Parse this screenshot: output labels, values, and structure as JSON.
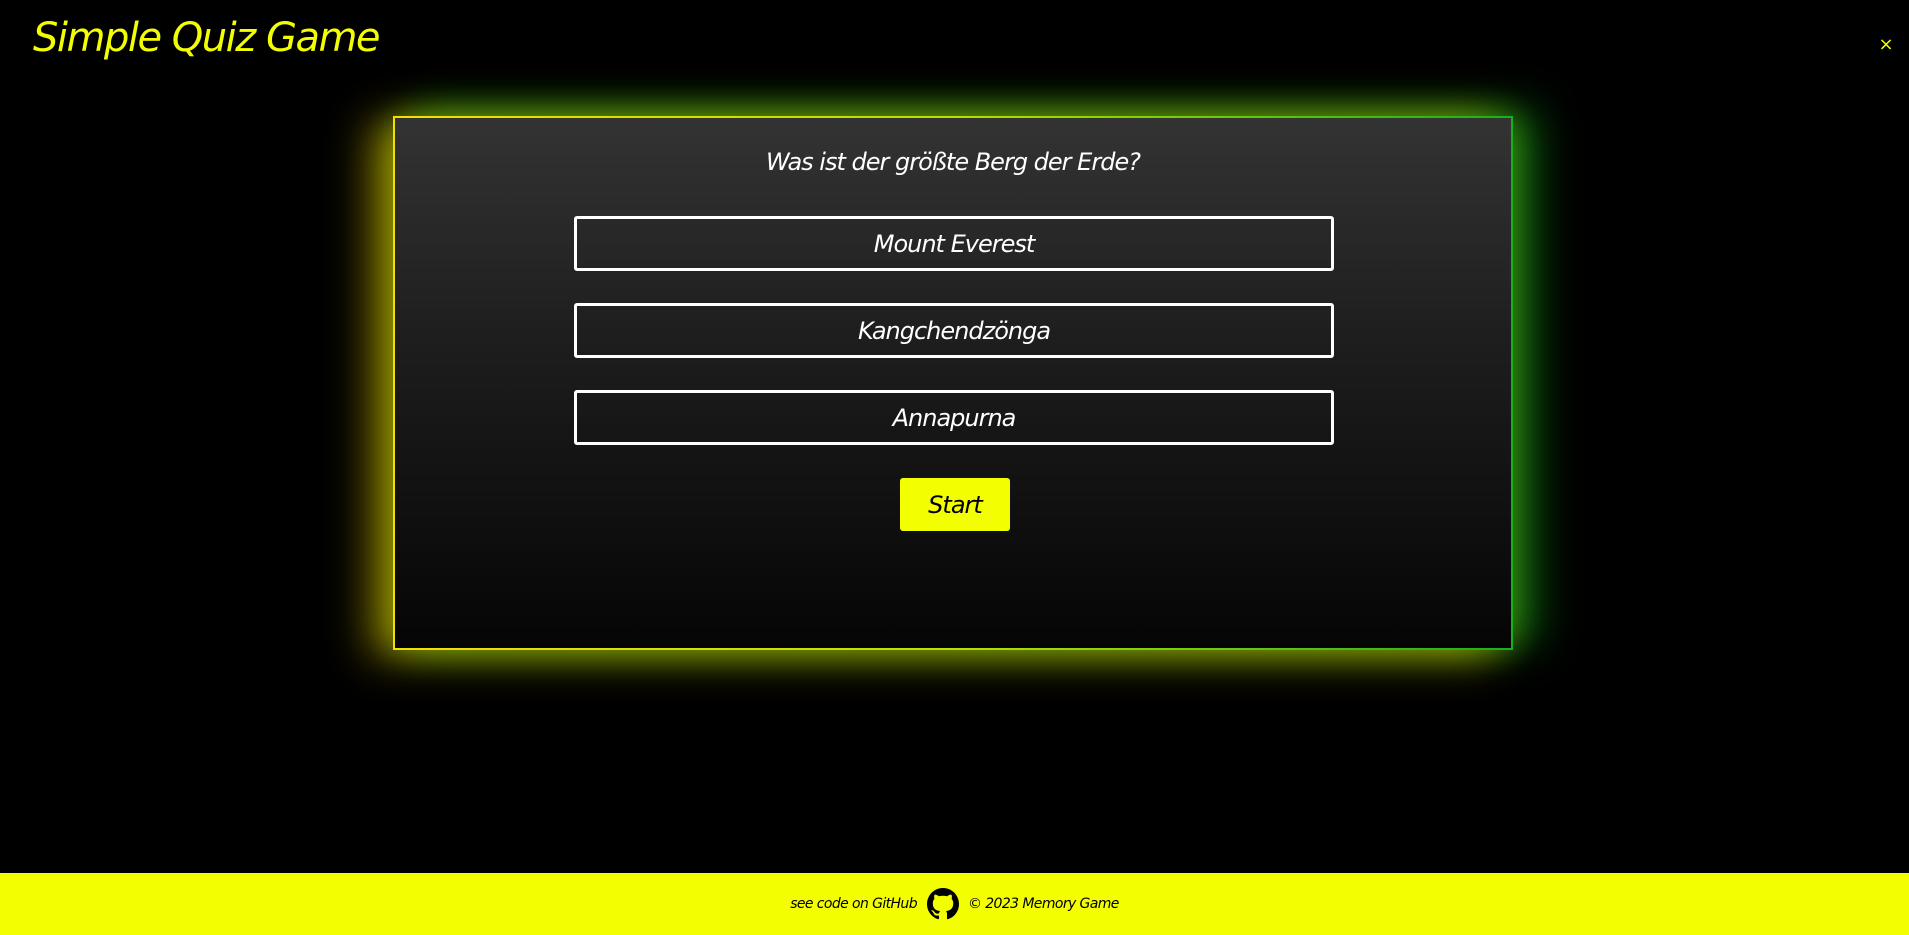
{
  "app": {
    "title": "Simple Quiz Game",
    "close_symbol": "×"
  },
  "quiz": {
    "question": "Was ist der größte Berg der Erde?",
    "answers": [
      {
        "label": "Mount Everest"
      },
      {
        "label": "Kangchendzönga"
      },
      {
        "label": "Annapurna"
      }
    ],
    "start_label": "Start"
  },
  "footer": {
    "github_link_text": "see code on GitHub",
    "github_icon": "github-icon",
    "copyright": "© 2023 Memory Game"
  },
  "colors": {
    "accent_yellow": "#f3ff00",
    "background": "#000000",
    "glow_green": "#18b01a",
    "text_white": "#ffffff"
  }
}
